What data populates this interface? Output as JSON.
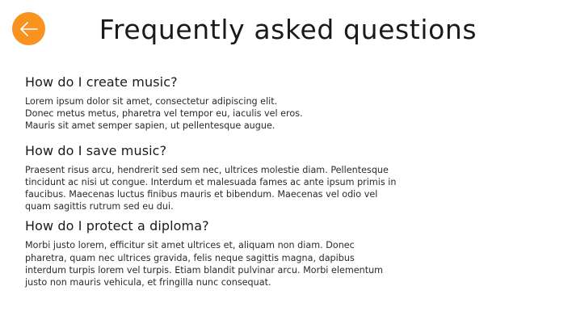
{
  "header": {
    "title": "Frequently asked questions",
    "back_icon": "arrow-left-icon",
    "accent_color": "#f7931e"
  },
  "faq": [
    {
      "question": "How do I create music?",
      "answer_lines": [
        "Lorem ipsum dolor sit amet, consectetur adipiscing elit.",
        "Donec metus metus, pharetra vel tempor eu, iaculis vel eros.",
        "Mauris sit amet semper sapien, ut pellentesque augue."
      ]
    },
    {
      "question": "How do I save music?",
      "answer_lines": [
        "Praesent risus arcu, hendrerit sed sem nec, ultrices molestie diam. Pellentesque",
        "tincidunt ac nisi ut congue. Interdum et malesuada fames ac ante ipsum primis in",
        "faucibus. Maecenas luctus finibus mauris et bibendum. Maecenas vel odio vel",
        "quam sagittis rutrum sed eu dui."
      ]
    },
    {
      "question": "How do I protect a diploma?",
      "answer_lines": [
        "Morbi justo lorem, efficitur sit amet ultrices et, aliquam non diam. Donec",
        "pharetra, quam nec ultrices gravida, felis neque sagittis magna, dapibus",
        "interdum turpis lorem vel turpis. Etiam blandit pulvinar arcu. Morbi elementum",
        "justo non mauris vehicula, et fringilla nunc consequat."
      ]
    }
  ]
}
